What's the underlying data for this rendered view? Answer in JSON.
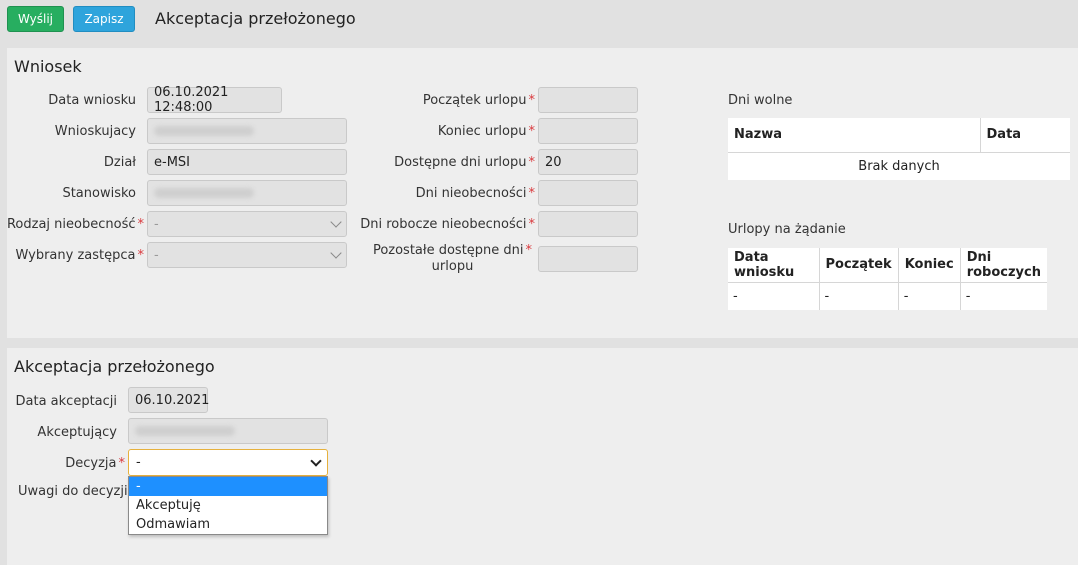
{
  "toolbar": {
    "send_label": "Wyślij",
    "save_label": "Zapisz",
    "title": "Akceptacja przełożonego"
  },
  "request": {
    "title": "Wniosek",
    "date_label": "Data wniosku",
    "date_value": "06.10.2021 12:48:00",
    "applicant_label": "Wnioskujacy",
    "department_label": "Dział",
    "department_value": "e-MSI",
    "position_label": "Stanowisko",
    "absence_type_label": "Rodzaj nieobecność",
    "absence_type_value": "-",
    "substitute_label": "Wybrany zastępca",
    "substitute_value": "-",
    "leave_start_label": "Początek urlopu",
    "leave_end_label": "Koniec urlopu",
    "available_days_label": "Dostępne dni urlopu",
    "available_days_value": "20",
    "absence_days_label": "Dni nieobecności",
    "work_absence_days_label": "Dni robocze nieobecności",
    "remaining_days_label_1": "Pozostałe dostępne dni",
    "remaining_days_label_2": "urlopu"
  },
  "holidays": {
    "label": "Dni wolne",
    "columns": [
      "Nazwa",
      "Data"
    ],
    "empty": "Brak danych"
  },
  "on_demand": {
    "label": "Urlopy na żądanie",
    "columns": [
      "Data wniosku",
      "Początek",
      "Koniec",
      "Dni roboczych"
    ],
    "rows": [
      [
        "-",
        "-",
        "-",
        "-"
      ]
    ]
  },
  "approval": {
    "title": "Akceptacja przełożonego",
    "date_label": "Data akceptacji",
    "date_value": "06.10.2021",
    "approver_label": "Akceptujący",
    "decision_label": "Decyzja",
    "decision_value": "-",
    "decision_options": [
      "-",
      "Akceptuję",
      "Odmawiam"
    ],
    "notes_label": "Uwagi do decyzji"
  },
  "colors": {
    "send": "#27ae60",
    "save": "#2ea4dc",
    "required": "#d9383c",
    "selected_option": "#1e90ff"
  },
  "required_mark": "*"
}
